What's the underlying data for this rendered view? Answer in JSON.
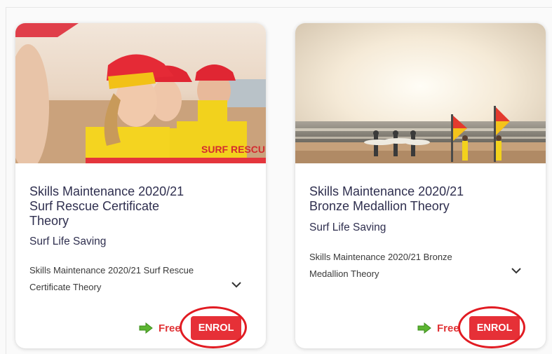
{
  "courses": [
    {
      "title_lines": [
        "Skills Maintenance 2020/21",
        "Surf Rescue Certificate",
        "Theory"
      ],
      "provider": "Surf Life Saving",
      "description": "Skills Maintenance 2020/21 Surf Rescue Certificate Theory",
      "price": "Free",
      "enrol_label": "ENROL",
      "image": "lifesavers-with-caps-image"
    },
    {
      "title_lines": [
        "Skills Maintenance 2020/21",
        "Bronze Medallion Theory"
      ],
      "provider": "Surf Life Saving",
      "description": "Skills Maintenance 2020/21 Bronze Medallion Theory",
      "price": "Free",
      "enrol_label": "ENROL",
      "image": "beach-sunset-surfers-image"
    }
  ],
  "colors": {
    "accent": "#e63037",
    "text": "#2f2f4f",
    "free_arrow": "#5cb531"
  }
}
